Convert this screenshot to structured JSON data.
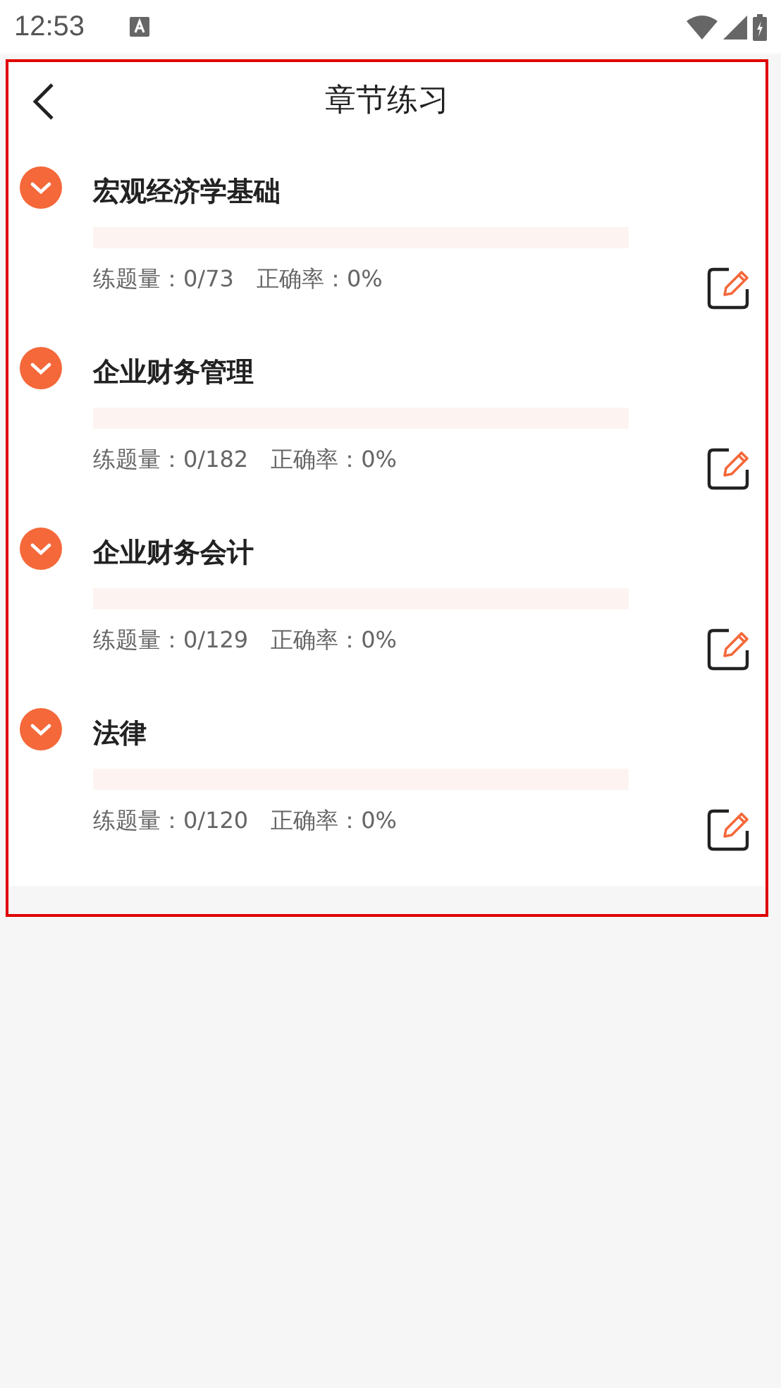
{
  "status_bar": {
    "time": "12:53"
  },
  "header": {
    "title": "章节练习"
  },
  "chapters": [
    {
      "title": "宏观经济学基础",
      "level": 0,
      "count": "练题量：0/73",
      "accuracy": "正确率：0%"
    },
    {
      "title": "企业财务管理",
      "level": 0,
      "count": "练题量：0/182",
      "accuracy": "正确率：0%"
    },
    {
      "title": "企业财务会计",
      "level": 0,
      "count": "练题量：0/129",
      "accuracy": "正确率：0%"
    },
    {
      "title": "法律",
      "level": 0,
      "count": "练题量：0/120",
      "accuracy": "正确率：0%"
    }
  ]
}
